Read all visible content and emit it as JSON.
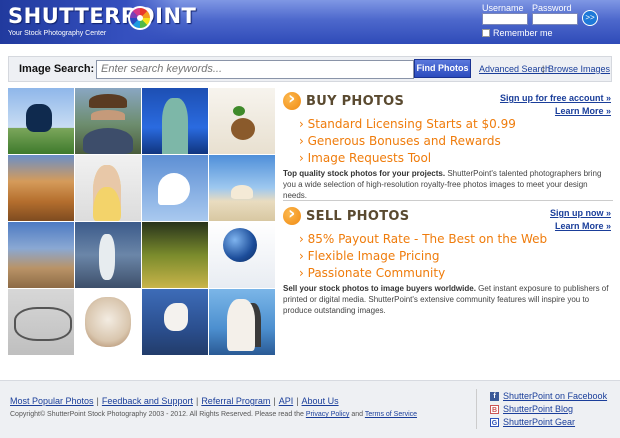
{
  "header": {
    "logo_text": "SHUTTERPOINT",
    "tagline": "Your Stock Photography Center",
    "username_label": "Username",
    "password_label": "Password",
    "go_label": ">>",
    "remember_label": "Remember me"
  },
  "search": {
    "label": "Image Search:",
    "placeholder": "Enter search keywords...",
    "button": "Find Photos",
    "advanced": "Advanced Search",
    "separator": "|",
    "browse": "Browse Images"
  },
  "photo_grid": {
    "tiles": [
      "football-player",
      "cowboy",
      "statue-of-liberty",
      "seedling-egg",
      "canyon",
      "businesswoman",
      "egret",
      "seashell-beach",
      "construction-workers",
      "ballet-dancer",
      "swamp-reflection",
      "globe-in-hand",
      "eyeglasses-newspaper",
      "bulldog",
      "unicorn",
      "beach-wedding"
    ]
  },
  "buy": {
    "title": "BUY PHOTOS",
    "link1": "Sign up for free account »",
    "link2": "Learn More »",
    "bullets": [
      "Standard Licensing Starts at $0.99",
      "Generous Bonuses and Rewards",
      "Image Requests Tool"
    ],
    "blurb_bold": "Top quality stock photos for your projects.",
    "blurb": " ShutterPoint's talented photographers bring you a wide selection of high-resolution royalty-free photos images to meet your design needs."
  },
  "sell": {
    "title": "SELL PHOTOS",
    "link1": "Sign up now »",
    "link2": "Learn More »",
    "bullets": [
      "85% Payout Rate - The Best on the Web",
      "Flexible Image Pricing",
      "Passionate Community"
    ],
    "blurb_bold": "Sell your stock photos to image buyers worldwide.",
    "blurb": " Get instant exposure to publishers of printed or digital media. ShutterPoint's extensive community features will inspire you to produce outstanding images."
  },
  "footer": {
    "links": [
      "Most Popular Photos",
      "Feedback and Support",
      "Referral Program",
      "API",
      "About Us"
    ],
    "pipe": "|",
    "copyright_text": "Copyright© ShutterPoint Stock Photography 2003 - 2012. All Rights Reserved. Please read the",
    "privacy": "Privacy Policy",
    "and": "and",
    "terms": "Terms of Service",
    "social": {
      "facebook": "ShutterPoint on Facebook",
      "blog": "ShutterPoint Blog",
      "gear": "ShutterPoint Gear"
    }
  },
  "colors": {
    "header_blue": "#3550bf",
    "accent_orange": "#ef7c0c",
    "link_blue": "#1a3e9a"
  }
}
